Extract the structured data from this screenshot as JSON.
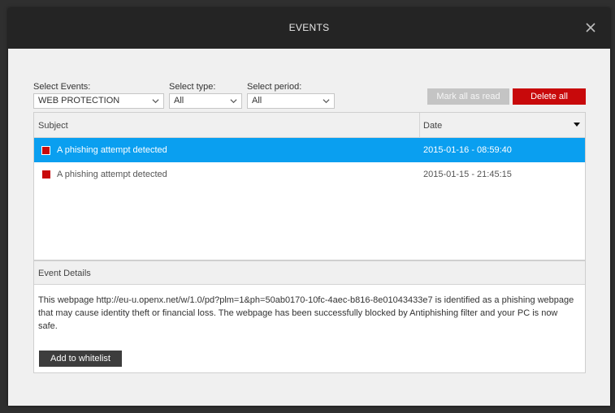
{
  "dialog": {
    "title": "EVENTS"
  },
  "filters": {
    "events": {
      "label": "Select Events:",
      "value": "WEB PROTECTION"
    },
    "type": {
      "label": "Select type:",
      "value": "All"
    },
    "period": {
      "label": "Select period:",
      "value": "All"
    }
  },
  "actions": {
    "mark_all_read": "Mark all as read",
    "delete_all": "Delete all"
  },
  "table": {
    "columns": [
      "Subject",
      "Date"
    ],
    "rows": [
      {
        "subject": "A phishing attempt detected",
        "date": "2015-01-16 - 08:59:40",
        "selected": true
      },
      {
        "subject": "A phishing attempt detected",
        "date": "2015-01-15 - 21:45:15",
        "selected": false
      }
    ]
  },
  "details": {
    "heading": "Event Details",
    "text": "This webpage http://eu-u.openx.net/w/1.0/pd?plm=1&ph=50ab0170-10fc-4aec-b816-8e01043433e7 is identified as a phishing webpage that may cause identity theft or financial loss. The webpage has been successfully blocked by Antiphishing filter and your PC is now safe.",
    "whitelist_button": "Add to whitelist"
  },
  "colors": {
    "titlebar": "#242424",
    "selected_row": "#0a9ff0",
    "danger": "#c8090b"
  }
}
